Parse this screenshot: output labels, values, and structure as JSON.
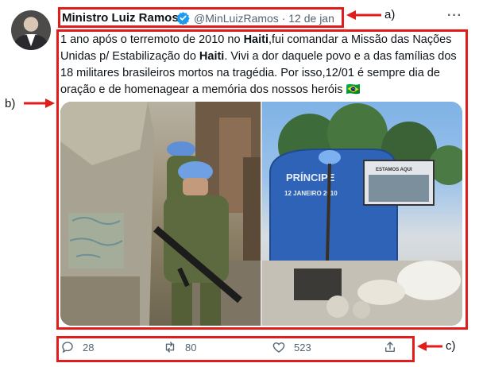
{
  "tweet": {
    "display_name": "Ministro Luiz Ramos",
    "handle": "@MinLuizRamos",
    "separator": "·",
    "date": "12 de jan",
    "more_label": "···",
    "text_parts": {
      "p1": "1 ano após o terremoto de 2010 no ",
      "b1": "Haiti",
      "p2": ",fui comandar a Missão das Nações Unidas p/ Estabilização do ",
      "b2": "Haiti",
      "p3": ". Vivi a dor daquele povo e a das famílias dos 18 militares brasileiros mortos na tragédia. Por isso,12/01 é sempre dia de oração e de homenagear a memória dos nossos heróis",
      "flag": "🇧🇷"
    },
    "media": {
      "right_sign_title": "PRÍNCIPE",
      "right_sign_subtitle": "12 JANEIRO 2010",
      "right_billboard": "ESTAMOS AQUI"
    },
    "actions": {
      "reply_count": "28",
      "retweet_count": "80",
      "like_count": "523"
    }
  },
  "annotations": {
    "a": "a)",
    "b": "b)",
    "c": "c)"
  },
  "colors": {
    "annotation_red": "#e21b1b",
    "verified_blue": "#1d9bf0",
    "muted_text": "#536471"
  }
}
